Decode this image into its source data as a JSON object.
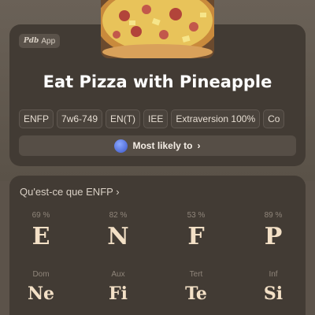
{
  "app_badge": {
    "brand": "Pdb",
    "label": "App"
  },
  "title": "Eat Pizza with Pineapple",
  "tags": [
    "ENFP",
    "7w6-749",
    "EN(T)",
    "IEE",
    "Extraversion 100%",
    "Co"
  ],
  "most_likely": {
    "label": "Most likely to",
    "chevron": "›",
    "avatar_icon": "love-emoji-icon"
  },
  "section": {
    "title": "Qu'est-ce que ENFP",
    "chevron": "›"
  },
  "letters": [
    {
      "pct": "69 %",
      "letter": "E"
    },
    {
      "pct": "82 %",
      "letter": "N"
    },
    {
      "pct": "53 %",
      "letter": "F"
    },
    {
      "pct": "89 %",
      "letter": "P"
    }
  ],
  "functions": [
    {
      "label": "Dom",
      "fn": "Ne"
    },
    {
      "label": "Aux",
      "fn": "Fi"
    },
    {
      "label": "Tert",
      "fn": "Te"
    },
    {
      "label": "Inf",
      "fn": "Si"
    }
  ]
}
